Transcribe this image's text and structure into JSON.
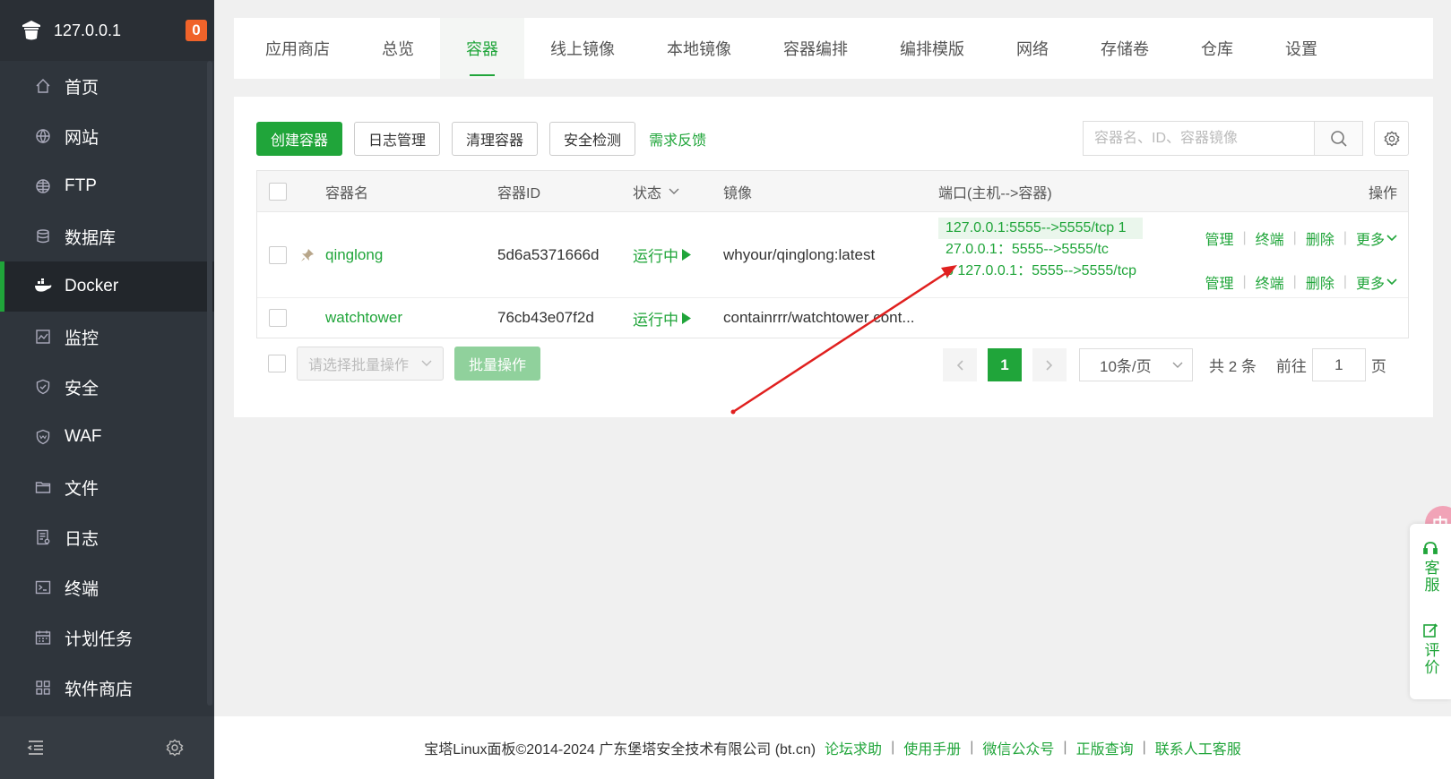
{
  "sidebar": {
    "server_ip": "127.0.0.1",
    "badge_count": "0",
    "items": [
      {
        "label": "首页",
        "icon": "home-icon"
      },
      {
        "label": "网站",
        "icon": "globe-icon"
      },
      {
        "label": "FTP",
        "icon": "ftp-globe-icon"
      },
      {
        "label": "数据库",
        "icon": "database-icon"
      },
      {
        "label": "Docker",
        "icon": "docker-whale-icon",
        "active": true
      },
      {
        "label": "监控",
        "icon": "monitor-icon"
      },
      {
        "label": "安全",
        "icon": "shield-icon"
      },
      {
        "label": "WAF",
        "icon": "waf-shield-icon"
      },
      {
        "label": "文件",
        "icon": "folder-icon"
      },
      {
        "label": "日志",
        "icon": "log-icon"
      },
      {
        "label": "终端",
        "icon": "terminal-icon"
      },
      {
        "label": "计划任务",
        "icon": "calendar-icon"
      },
      {
        "label": "软件商店",
        "icon": "grid-icon"
      }
    ]
  },
  "tabs": [
    {
      "label": "应用商店"
    },
    {
      "label": "总览"
    },
    {
      "label": "容器",
      "active": true
    },
    {
      "label": "线上镜像"
    },
    {
      "label": "本地镜像"
    },
    {
      "label": "容器编排"
    },
    {
      "label": "编排模版"
    },
    {
      "label": "网络"
    },
    {
      "label": "存储卷"
    },
    {
      "label": "仓库"
    },
    {
      "label": "设置"
    }
  ],
  "toolbar": {
    "create": "创建容器",
    "logs": "日志管理",
    "clean": "清理容器",
    "security": "安全检测",
    "feedback": "需求反馈",
    "search_placeholder": "容器名、ID、容器镜像"
  },
  "table": {
    "headers": {
      "name": "容器名",
      "id": "容器ID",
      "status": "状态",
      "image": "镜像",
      "port": "端口(主机-->容器)",
      "ops": "操作"
    },
    "rows": [
      {
        "name": "qinglong",
        "id": "5d6a5371666d",
        "status": "运行中",
        "image": "whyour/qinglong:latest",
        "ports": [
          "127.0.0.1:5555-->5555/tcp  1",
          "27.0.0.1：5555-->5555/tc",
          "p 127.0.0.1：5555-->5555/tcp"
        ]
      },
      {
        "name": "watchtower",
        "id": "76cb43e07f2d",
        "status": "运行中",
        "image": "containrrr/watchtower cont..."
      }
    ],
    "ops": {
      "manage": "管理",
      "terminal": "终端",
      "delete": "删除",
      "more": "更多"
    }
  },
  "batch": {
    "select_placeholder": "请选择批量操作",
    "button": "批量操作"
  },
  "pager": {
    "current": "1",
    "page_size": "10条/页",
    "total": "共 2 条",
    "goto_label": "前往",
    "goto_value": "1",
    "page_unit": "页"
  },
  "footer": {
    "copyright": "宝塔Linux面板©2014-2024 广东堡塔安全技术有限公司 (bt.cn)",
    "links": [
      "论坛求助",
      "使用手册",
      "微信公众号",
      "正版查询",
      "联系人工客服"
    ],
    "separator": "|"
  },
  "float": {
    "lang": "中",
    "service": "客服",
    "review": "评价"
  },
  "colors": {
    "accent": "#20a53a",
    "sidebar_bg": "#2f353c",
    "badge": "#f0632a",
    "annotation_arrow": "#e0201f"
  }
}
